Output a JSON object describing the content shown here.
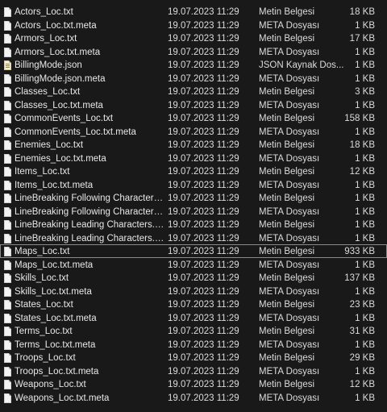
{
  "files": [
    {
      "name": "Actors_Loc.txt",
      "date": "19.07.2023 11:29",
      "type": "Metin Belgesi",
      "size": "18 KB",
      "icon": "text-file-icon"
    },
    {
      "name": "Actors_Loc.txt.meta",
      "date": "19.07.2023 11:29",
      "type": "META Dosyası",
      "size": "1 KB",
      "icon": "text-file-icon"
    },
    {
      "name": "Armors_Loc.txt",
      "date": "19.07.2023 11:29",
      "type": "Metin Belgesi",
      "size": "17 KB",
      "icon": "text-file-icon"
    },
    {
      "name": "Armors_Loc.txt.meta",
      "date": "19.07.2023 11:29",
      "type": "META Dosyası",
      "size": "1 KB",
      "icon": "text-file-icon"
    },
    {
      "name": "BillingMode.json",
      "date": "19.07.2023 11:29",
      "type": "JSON Kaynak Dos...",
      "size": "1 KB",
      "icon": "json-file-icon"
    },
    {
      "name": "BillingMode.json.meta",
      "date": "19.07.2023 11:29",
      "type": "META Dosyası",
      "size": "1 KB",
      "icon": "text-file-icon"
    },
    {
      "name": "Classes_Loc.txt",
      "date": "19.07.2023 11:29",
      "type": "Metin Belgesi",
      "size": "3 KB",
      "icon": "text-file-icon"
    },
    {
      "name": "Classes_Loc.txt.meta",
      "date": "19.07.2023 11:29",
      "type": "META Dosyası",
      "size": "1 KB",
      "icon": "text-file-icon"
    },
    {
      "name": "CommonEvents_Loc.txt",
      "date": "19.07.2023 11:29",
      "type": "Metin Belgesi",
      "size": "158 KB",
      "icon": "text-file-icon"
    },
    {
      "name": "CommonEvents_Loc.txt.meta",
      "date": "19.07.2023 11:29",
      "type": "META Dosyası",
      "size": "1 KB",
      "icon": "text-file-icon"
    },
    {
      "name": "Enemies_Loc.txt",
      "date": "19.07.2023 11:29",
      "type": "Metin Belgesi",
      "size": "18 KB",
      "icon": "text-file-icon"
    },
    {
      "name": "Enemies_Loc.txt.meta",
      "date": "19.07.2023 11:29",
      "type": "META Dosyası",
      "size": "1 KB",
      "icon": "text-file-icon"
    },
    {
      "name": "Items_Loc.txt",
      "date": "19.07.2023 11:29",
      "type": "Metin Belgesi",
      "size": "12 KB",
      "icon": "text-file-icon"
    },
    {
      "name": "Items_Loc.txt.meta",
      "date": "19.07.2023 11:29",
      "type": "META Dosyası",
      "size": "1 KB",
      "icon": "text-file-icon"
    },
    {
      "name": "LineBreaking Following Characters.txt",
      "date": "19.07.2023 11:29",
      "type": "Metin Belgesi",
      "size": "1 KB",
      "icon": "text-file-icon"
    },
    {
      "name": "LineBreaking Following Characters.txt.m...",
      "date": "19.07.2023 11:29",
      "type": "META Dosyası",
      "size": "1 KB",
      "icon": "text-file-icon"
    },
    {
      "name": "LineBreaking Leading Characters.txt",
      "date": "19.07.2023 11:29",
      "type": "Metin Belgesi",
      "size": "1 KB",
      "icon": "text-file-icon"
    },
    {
      "name": "LineBreaking Leading Characters.txt.meta",
      "date": "19.07.2023 11:29",
      "type": "META Dosyası",
      "size": "1 KB",
      "icon": "text-file-icon"
    },
    {
      "name": "Maps_Loc.txt",
      "date": "19.07.2023 11:29",
      "type": "Metin Belgesi",
      "size": "933 KB",
      "icon": "text-file-icon",
      "selected": true
    },
    {
      "name": "Maps_Loc.txt.meta",
      "date": "19.07.2023 11:29",
      "type": "META Dosyası",
      "size": "1 KB",
      "icon": "text-file-icon"
    },
    {
      "name": "Skills_Loc.txt",
      "date": "19.07.2023 11:29",
      "type": "Metin Belgesi",
      "size": "137 KB",
      "icon": "text-file-icon"
    },
    {
      "name": "Skills_Loc.txt.meta",
      "date": "19.07.2023 11:29",
      "type": "META Dosyası",
      "size": "1 KB",
      "icon": "text-file-icon"
    },
    {
      "name": "States_Loc.txt",
      "date": "19.07.2023 11:29",
      "type": "Metin Belgesi",
      "size": "23 KB",
      "icon": "text-file-icon"
    },
    {
      "name": "States_Loc.txt.meta",
      "date": "19.07.2023 11:29",
      "type": "META Dosyası",
      "size": "1 KB",
      "icon": "text-file-icon"
    },
    {
      "name": "Terms_Loc.txt",
      "date": "19.07.2023 11:29",
      "type": "Metin Belgesi",
      "size": "31 KB",
      "icon": "text-file-icon"
    },
    {
      "name": "Terms_Loc.txt.meta",
      "date": "19.07.2023 11:29",
      "type": "META Dosyası",
      "size": "1 KB",
      "icon": "text-file-icon"
    },
    {
      "name": "Troops_Loc.txt",
      "date": "19.07.2023 11:29",
      "type": "Metin Belgesi",
      "size": "29 KB",
      "icon": "text-file-icon"
    },
    {
      "name": "Troops_Loc.txt.meta",
      "date": "19.07.2023 11:29",
      "type": "META Dosyası",
      "size": "1 KB",
      "icon": "text-file-icon"
    },
    {
      "name": "Weapons_Loc.txt",
      "date": "19.07.2023 11:29",
      "type": "Metin Belgesi",
      "size": "12 KB",
      "icon": "text-file-icon"
    },
    {
      "name": "Weapons_Loc.txt.meta",
      "date": "19.07.2023 11:29",
      "type": "META Dosyası",
      "size": "1 KB",
      "icon": "text-file-icon"
    }
  ]
}
